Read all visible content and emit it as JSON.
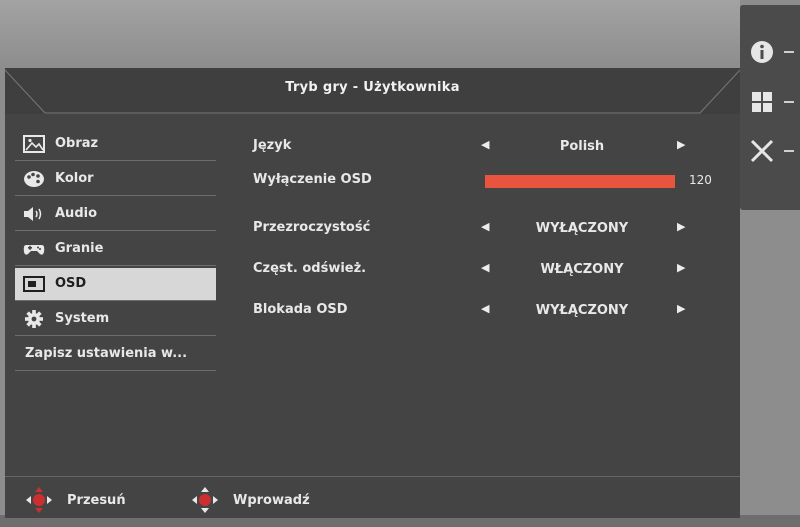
{
  "window": {
    "title": "Tryb gry - Użytkownika"
  },
  "menu": {
    "items": [
      {
        "label": "Obraz",
        "icon": "image-icon"
      },
      {
        "label": "Kolor",
        "icon": "palette-icon"
      },
      {
        "label": "Audio",
        "icon": "speaker-icon"
      },
      {
        "label": "Granie",
        "icon": "gamepad-icon"
      },
      {
        "label": "OSD",
        "icon": "osd-icon",
        "active": true
      },
      {
        "label": "System",
        "icon": "gear-icon"
      },
      {
        "label": "Zapisz ustawienia w..."
      }
    ]
  },
  "settings": {
    "language": {
      "label": "Język",
      "value": "Polish"
    },
    "osd_timeout": {
      "label": "Wyłączenie OSD",
      "value": "120",
      "level": 1.0
    },
    "transparency": {
      "label": "Przezroczystość",
      "value": "WYŁĄCZONY"
    },
    "refresh_rate": {
      "label": "Częst. odśwież.",
      "value": "WŁĄCZONY"
    },
    "osd_lock": {
      "label": "Blokada OSD",
      "value": "WYŁĄCZONY"
    },
    "left_arrow": "◀",
    "right_arrow": "▶"
  },
  "footer": {
    "move_label": "Przesuń",
    "enter_label": "Wprowadź"
  },
  "side_panel": {
    "icons": [
      "info-icon",
      "grid-icon",
      "close-icon"
    ]
  },
  "colors": {
    "accent": "#e8543e",
    "panel": "#444444",
    "active_item": "#d7d7d7"
  }
}
